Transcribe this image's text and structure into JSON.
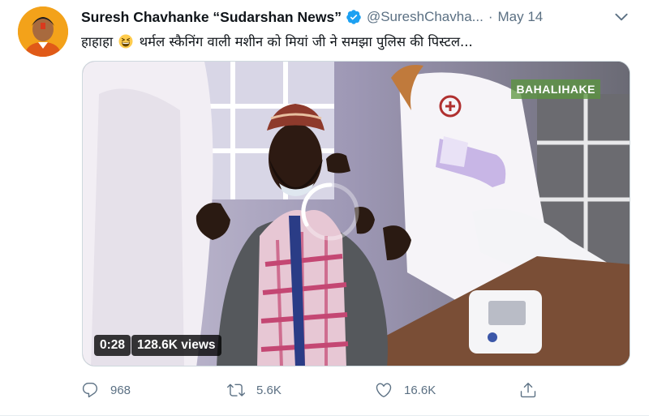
{
  "tweet": {
    "author_name": "Suresh Chavhanke “Sudarshan News”",
    "handle": "@SureshChavha...",
    "separator": "·",
    "date": "May 14",
    "text_before_emoji": "हाहाहा",
    "emoji": "grinning-squinting-face",
    "text_after_emoji": "थर्मल स्कैनिंग वाली मशीन को मियां जी ने समझा पुलिस की पिस्टल...",
    "verified": true
  },
  "media": {
    "watermark": "BAHALIHAKE",
    "duration": "0:28",
    "views": "128.6K views"
  },
  "actions": {
    "reply_count": "968",
    "retweet_count": "5.6K",
    "like_count": "16.6K"
  },
  "icons": {
    "verified": "verified-badge-icon",
    "menu": "chevron-down-icon",
    "reply": "reply-icon",
    "retweet": "retweet-icon",
    "like": "heart-icon",
    "share": "share-icon",
    "loading": "loading-spinner-icon"
  },
  "colors": {
    "text_primary": "#0f1419",
    "text_secondary": "#5b7083",
    "verified_blue": "#1da1f2",
    "avatar_bg": "#f3a21a"
  }
}
